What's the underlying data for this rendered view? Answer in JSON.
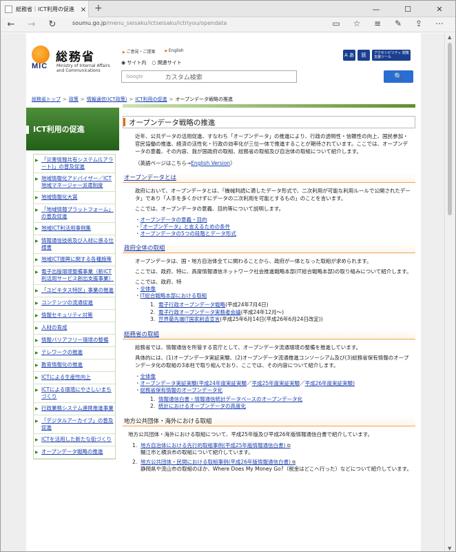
{
  "browser": {
    "tab_title": "総務省｜ICT利用の促進",
    "tab_close": "×",
    "new_tab": "+",
    "address_domain": "soumu.go.jp",
    "address_path": "/menu_seisaku/ictseisaku/ictriyou/opendata",
    "controls": {
      "minimize": "—",
      "maximize": "☐",
      "close": "✕"
    },
    "nav": {
      "back": "←",
      "forward": "→",
      "refresh": "↻"
    },
    "toolbar_icons": [
      "reading-view-icon",
      "favorite-star-icon",
      "hub-icon",
      "web-note-icon",
      "share-icon",
      "more-icon"
    ]
  },
  "header": {
    "logo_mic": "MIC",
    "logo_jp": "総務省",
    "logo_en_1": "Ministry of Internal Affairs",
    "logo_en_2": "and Communications",
    "links": [
      "ご意見・ご提案",
      "English"
    ],
    "radio_site": "サイト内",
    "radio_related": "関連サイト",
    "search_google": "Google",
    "search_placeholder": "カスタム検索",
    "search_button": "🔍",
    "tool_font": "A あ",
    "tool_speech": "読",
    "tool_access": "アクセシビリティ 閲覧支援ツール"
  },
  "breadcrumb": [
    "総務省トップ",
    "政策",
    "情報通信(ICT政策)",
    "ICT利用の促進",
    "オープンデータ戦略の推進"
  ],
  "sidebar": {
    "title": "ICT利用の促進",
    "items": [
      "「災害情報共有システム(Lアラート)」の普及促進",
      "地域情報化アドバイザー／ICT地域マネージャー派遣制度",
      "地域情報化大賞",
      "「地域情報プラットフォーム」の普及促進",
      "地域ICT利活用事例集",
      "情報通信技術及び人材に係る仕様書",
      "地域ICT振興に関する各種施策",
      "電子出版環境整備事業（新ICT利活用サービス創出支援事業）",
      "「ユビキタス特区」事業の推進",
      "コンテンツの流通促進",
      "情報セキュリティ対策",
      "人材の育成",
      "情報バリアフリー環境の整備",
      "テレワークの推進",
      "教育情報化の推進",
      "ICTによる生産性向上",
      "ICTによる環境にやさしいまちづくり",
      "行政業務システム連携推進事業",
      "「デジタルアーカイブ」の普及促進",
      "ICTを活用した新たな街づくり",
      "オープンデータ戦略の推進"
    ]
  },
  "content": {
    "title": "オープンデータ戦略の推進",
    "intro": "近年、公共データの活用促進、すなわち「オープンデータ」の推進により、行政の透明性・信頼性の向上、国民参加・官民協働の推進、経済の活性化・行政の効率化が三位一体で推進することが期待されています。ここでは、オープンデータの意義、その内容、我が国政府の取組、総務省の取組及び自治体の取組について紹介します。",
    "english_prefix": "（英語ページはこちら→",
    "english_link": "English Version",
    "english_suffix": "）",
    "s1": {
      "heading": "オープンデータとは",
      "p1": "政府において、オープンデータとは、「機械判読に適したデータ形式で、二次利用が可能な利用ルールで公開されたデータ」であり「人手を多くかけずにデータの二次利用を可能とするもの」のことを言います。",
      "p2": "ここでは、オープンデータの意義、目的等について説明します。",
      "links": [
        "オープンデータの意義・目的",
        "「オープンデータ」と言えるための条件",
        "オープンデータの5つの段階とデータ形式"
      ]
    },
    "s2": {
      "heading": "政府全体の取組",
      "p1": "オープンデータは、国・地方自治体全てに関わることから、政府が一体となった取組が求められます。",
      "p2": "ここでは、政府、特に、高度情報通信ネットワーク社会推進戦略本部(IT総合戦略本部)の取り組みについて紹介します。",
      "p3": "ここでは、政府、特",
      "l1": "全体像",
      "l2": "IT総合戦略本部における取組",
      "sub": [
        {
          "n": "1.",
          "link": "電子行政オープンデータ戦略",
          "tail": "(平成24年7月4日)"
        },
        {
          "n": "2.",
          "link": "電子行政オープンデータ実務者会議",
          "tail": "(平成24年12月～)"
        },
        {
          "n": "3.",
          "link": "世界最先端IT国家創造宣言",
          "tail": "(平成25年6月14日(平成26年6月24日改定))"
        }
      ]
    },
    "s3": {
      "heading": "総務省の取組",
      "p1": "総務省では、情報通信を所管する官庁として、オープンデータ流通環境の整備を推進しています。",
      "p2": "具体的には、(1)オープンデータ実証実験、(2)オープンデータ流通推進コンソーシアム及び(3)総務省保有情報のオープンデータ化の取組の3本柱で取り組んでおり、ここでは、その内容について紹介します。",
      "l1": "全体像",
      "l2a": "オープンデータ実証実験",
      "l2b": "(平成24年度実証実験",
      "l2sep1": "／",
      "l2c": "平成25年度実証実験",
      "l2sep2": "／",
      "l2d": "平成26年度実証実験)",
      "l3": "総務省保有情報のオープンデータ化",
      "sub": [
        {
          "n": "1.",
          "link": "情報通信白書・情報通信統計データベースのオープンデータ化"
        },
        {
          "n": "2.",
          "link": "統計におけるオープンデータの高度化"
        }
      ]
    },
    "s4": {
      "heading": "地方公共団体・海外における取組",
      "p1": "地方公共団体・海外における取組について、平成25年版及び平成26年版情報通信白書で紹介しています。",
      "items": [
        {
          "n": "1.",
          "link": "地方自治体における先行的取組事例(平成25年版情報通信白書)",
          "desc": "鯖江市と横浜市の取組について紹介しています。"
        },
        {
          "n": "2.",
          "link": "地方公共団体・民間における取組事例(平成26年版情報通信白書)",
          "desc": "静岡県や流山市の取組のほか、Where Does My Money Go?（税金はどこへ行った）などについて紹介しています。"
        }
      ]
    }
  }
}
